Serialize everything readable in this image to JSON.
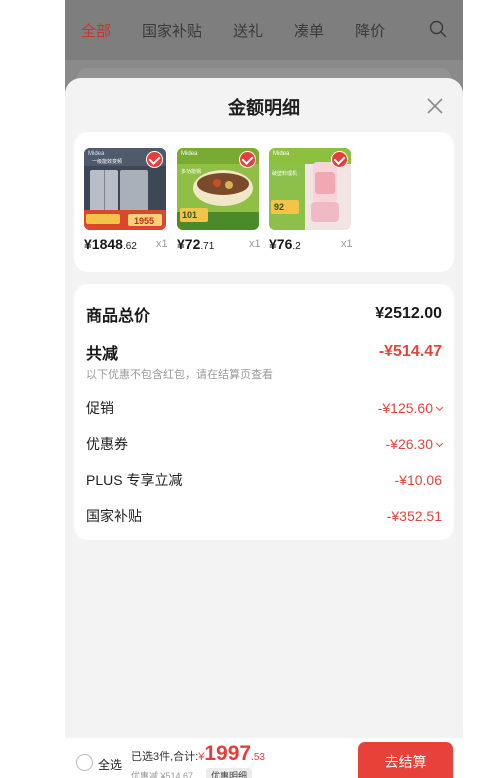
{
  "nav": {
    "tabs": [
      "全部",
      "国家补贴",
      "送礼",
      "凑单",
      "降价"
    ],
    "active_index": 0
  },
  "sheet": {
    "title": "金额明细",
    "goods": [
      {
        "price_main": "¥1848",
        "price_decimal": ".62",
        "qty": "x1",
        "brand": "Midea",
        "tag": "一级能效变频",
        "badge": "1955",
        "theme": "fridge"
      },
      {
        "price_main": "¥72",
        "price_decimal": ".71",
        "qty": "x1",
        "brand": "Midea",
        "tag": "多功能锅",
        "badge": "101",
        "theme": "pot"
      },
      {
        "price_main": "¥76",
        "price_decimal": ".2",
        "qty": "x1",
        "brand": "Midea",
        "tag": "破壁料理机",
        "badge": "92",
        "theme": "blender"
      }
    ],
    "total_label": "商品总价",
    "total_value": "¥2512.00",
    "discount_label": "共减",
    "discount_value": "-¥514.47",
    "note": "以下优惠不包含红包，请在结算页查看",
    "items": [
      {
        "label": "促销",
        "value": "-¥125.60",
        "expandable": true
      },
      {
        "label": "优惠券",
        "value": "-¥26.30",
        "expandable": true
      },
      {
        "label": "PLUS 专享立减",
        "value": "-¥10.06",
        "expandable": false
      },
      {
        "label": "国家补贴",
        "value": "-¥352.51",
        "expandable": false
      }
    ]
  },
  "bottom": {
    "select_all": "全选",
    "selected_text": "已选3件,合计:",
    "currency": "¥",
    "amount_int": "1997",
    "amount_dec": ".53",
    "saved_text": "优惠减 ¥514.67",
    "detail_label": "优惠明细",
    "checkout_label": "去结算"
  },
  "colors": {
    "accent": "#e8413a",
    "price_red": "#e1463c",
    "overlay_gray": "#7e7e7e"
  }
}
